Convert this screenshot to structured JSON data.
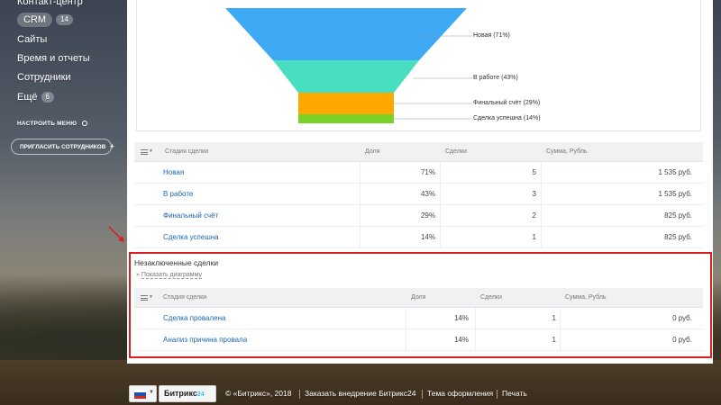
{
  "sidebar": {
    "items": [
      {
        "label": "Контакт-центр"
      },
      {
        "label": "CRM",
        "badge": "14"
      },
      {
        "label": "Сайты"
      },
      {
        "label": "Время и отчеты"
      },
      {
        "label": "Сотрудники"
      },
      {
        "label": "Ещё",
        "badge": "6"
      }
    ],
    "configure_menu": "НАСТРОИТЬ МЕНЮ",
    "invite_button": "ПРИГЛАСИТЬ СОТРУДНИКОВ"
  },
  "funnel": {
    "stages": [
      {
        "label": "Новая (71%)",
        "color": "#3ea9f4"
      },
      {
        "label": "В работе (43%)",
        "color": "#48dfc0"
      },
      {
        "label": "Финальный счёт (29%)",
        "color": "#ffa900"
      },
      {
        "label": "Сделка успешна (14%)",
        "color": "#7ad128"
      }
    ]
  },
  "deals_table": {
    "columns": [
      "Стадия сделки",
      "Доля",
      "Сделки",
      "Сумма, Рубль"
    ],
    "rows": [
      {
        "stage": "Новая",
        "share": "71%",
        "deals": "5",
        "sum": "1 535 руб."
      },
      {
        "stage": "В работе",
        "share": "43%",
        "deals": "3",
        "sum": "1 535 руб."
      },
      {
        "stage": "Финальный счёт",
        "share": "29%",
        "deals": "2",
        "sum": "825 руб."
      },
      {
        "stage": "Сделка успешна",
        "share": "14%",
        "deals": "1",
        "sum": "825 руб."
      }
    ]
  },
  "unclosed": {
    "title": "Незаключенные сделки",
    "show_diagram": "Показать диаграмму",
    "columns": [
      "Стадия сделки",
      "Доля",
      "Сделки",
      "Сумма, Рубль"
    ],
    "rows": [
      {
        "stage": "Сделка провалена",
        "share": "14%",
        "deals": "1",
        "sum": "0 руб."
      },
      {
        "stage": "Анализ причина провала",
        "share": "14%",
        "deals": "1",
        "sum": "0 руб."
      }
    ]
  },
  "footer": {
    "brand": "Битрикс",
    "brand_suffix": "24",
    "copyright": "© «Битрикс», 2018",
    "order_link": "Заказать внедрение Битрикс24",
    "theme_link": "Тема оформления",
    "print_link": "Печать"
  },
  "colors": {
    "highlight": "#d7201f",
    "link": "#2067b0"
  }
}
